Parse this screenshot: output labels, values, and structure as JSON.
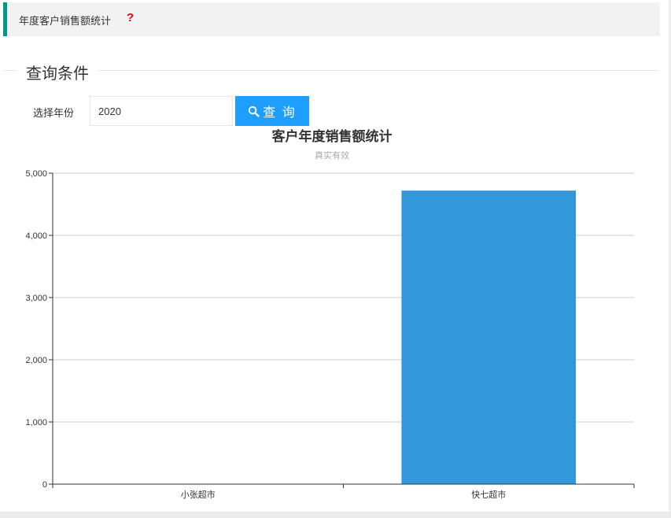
{
  "header": {
    "title": "年度客户销售额统计",
    "help_icon": "question-icon",
    "accent_color": "#009688"
  },
  "query": {
    "legend": "查询条件",
    "year_label": "选择年份",
    "year_value": "2020",
    "search_label": "查 询",
    "search_icon": "search-icon",
    "button_color": "#1e9fff"
  },
  "chart_data": {
    "type": "bar",
    "title": "客户年度销售额统计",
    "subtitle": "真实有效",
    "categories": [
      "小张超市",
      "快七超市"
    ],
    "values": [
      0,
      4720
    ],
    "ylim": [
      0,
      5000
    ],
    "yticks": [
      0,
      1000,
      2000,
      3000,
      4000,
      5000
    ],
    "ytick_labels": [
      "0",
      "1,000",
      "2,000",
      "3,000",
      "4,000",
      "5,000"
    ],
    "xlabel": "",
    "ylabel": "",
    "grid": true,
    "bar_color": "#3398db"
  }
}
